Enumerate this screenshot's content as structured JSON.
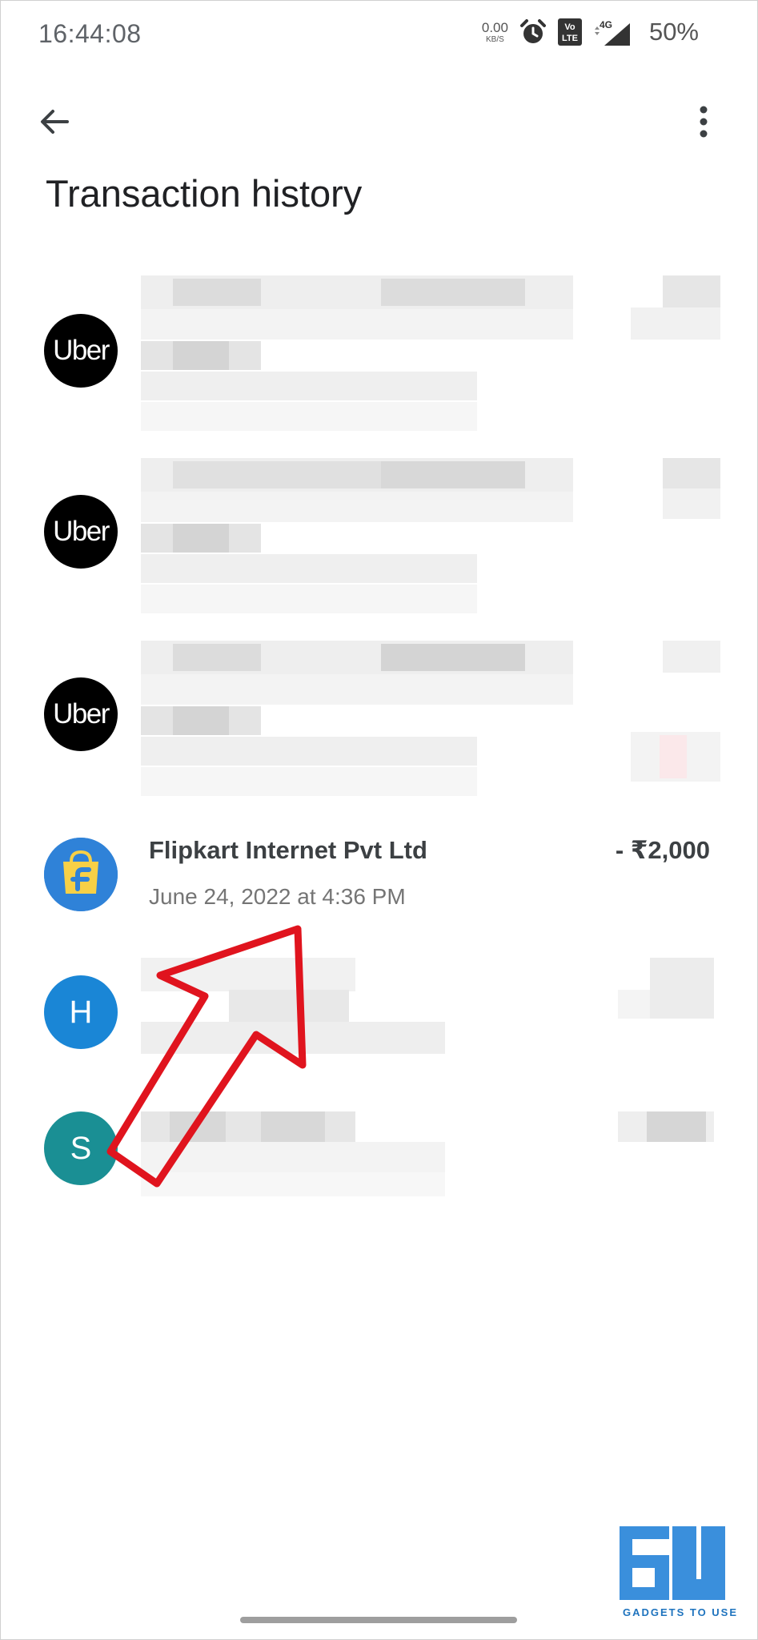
{
  "status_bar": {
    "time": "16:44:08",
    "net_speed_value": "0.00",
    "net_speed_unit": "KB/S",
    "volte_label": "Vo LTE",
    "network_label": "4G",
    "battery": "50%"
  },
  "header": {
    "title": "Transaction history"
  },
  "transactions": [
    {
      "avatar_text": "Uber"
    },
    {
      "avatar_text": "Uber"
    },
    {
      "avatar_text": "Uber"
    },
    {
      "name": "Flipkart Internet Pvt Ltd",
      "date": "June 24, 2022 at 4:36 PM",
      "amount": "- ₹2,000"
    },
    {
      "avatar_text": "H",
      "avatar_color": "#1a86d6"
    },
    {
      "avatar_text": "S",
      "avatar_color": "#1a8f94"
    }
  ],
  "watermark": {
    "text": "GADGETS TO USE"
  },
  "colors": {
    "uber_avatar": "#000000",
    "arrow": "#e0141e",
    "watermark": "#1e73be"
  }
}
